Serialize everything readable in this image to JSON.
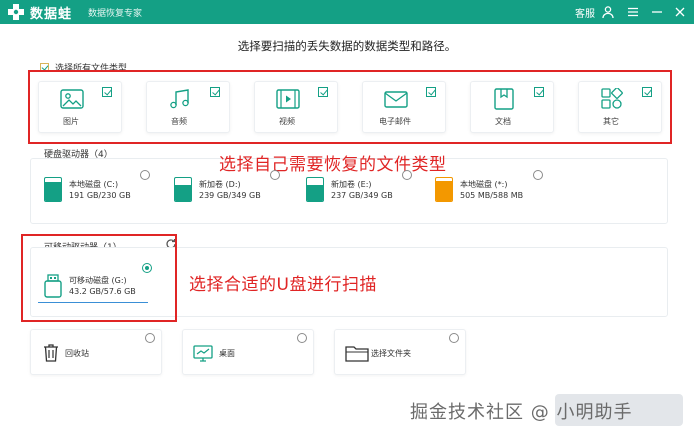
{
  "app": {
    "title": "数据蛙",
    "subtitle": "数据恢复专家",
    "support_label": "客服",
    "brand_color": "#14a085"
  },
  "instruction": "选择要扫描的丢失数据的数据类型和路径。",
  "select_all": {
    "label": "选择所有文件类型",
    "checked": true
  },
  "file_types": [
    {
      "label": "图片",
      "icon": "image-icon",
      "checked": true
    },
    {
      "label": "音频",
      "icon": "music-icon",
      "checked": true
    },
    {
      "label": "视频",
      "icon": "video-icon",
      "checked": true
    },
    {
      "label": "电子邮件",
      "icon": "email-icon",
      "checked": true
    },
    {
      "label": "文档",
      "icon": "document-icon",
      "checked": true
    },
    {
      "label": "其它",
      "icon": "other-icon",
      "checked": true
    }
  ],
  "annotations": {
    "file_type_note": "选择自己需要恢复的文件类型",
    "usb_note": "选择合适的U盘进行扫描"
  },
  "hard_drives": {
    "title": "硬盘驱动器（4）",
    "items": [
      {
        "name": "本地磁盘 (C:)",
        "size": "191 GB/230 GB",
        "used_fraction": 0.83,
        "color": "#14a085",
        "selected": false
      },
      {
        "name": "新加卷 (D:)",
        "size": "239 GB/349 GB",
        "used_fraction": 0.68,
        "color": "#14a085",
        "selected": false
      },
      {
        "name": "新加卷 (E:)",
        "size": "237 GB/349 GB",
        "used_fraction": 0.68,
        "color": "#14a085",
        "selected": false
      },
      {
        "name": "本地磁盘 (*:)",
        "size": "505 MB/588 MB",
        "used_fraction": 0.86,
        "color": "#f39800",
        "selected": false
      }
    ]
  },
  "removable_drives": {
    "title": "可移动驱动器（1）",
    "items": [
      {
        "name": "可移动磁盘 (G:)",
        "size": "43.2 GB/57.6 GB",
        "selected": true
      }
    ]
  },
  "locations": [
    {
      "label": "回收站",
      "icon": "recycle-bin-icon"
    },
    {
      "label": "桌面",
      "icon": "desktop-icon"
    },
    {
      "label": "选择文件夹",
      "icon": "folder-icon"
    }
  ],
  "watermark": "掘金技术社区 @ 小明助手"
}
